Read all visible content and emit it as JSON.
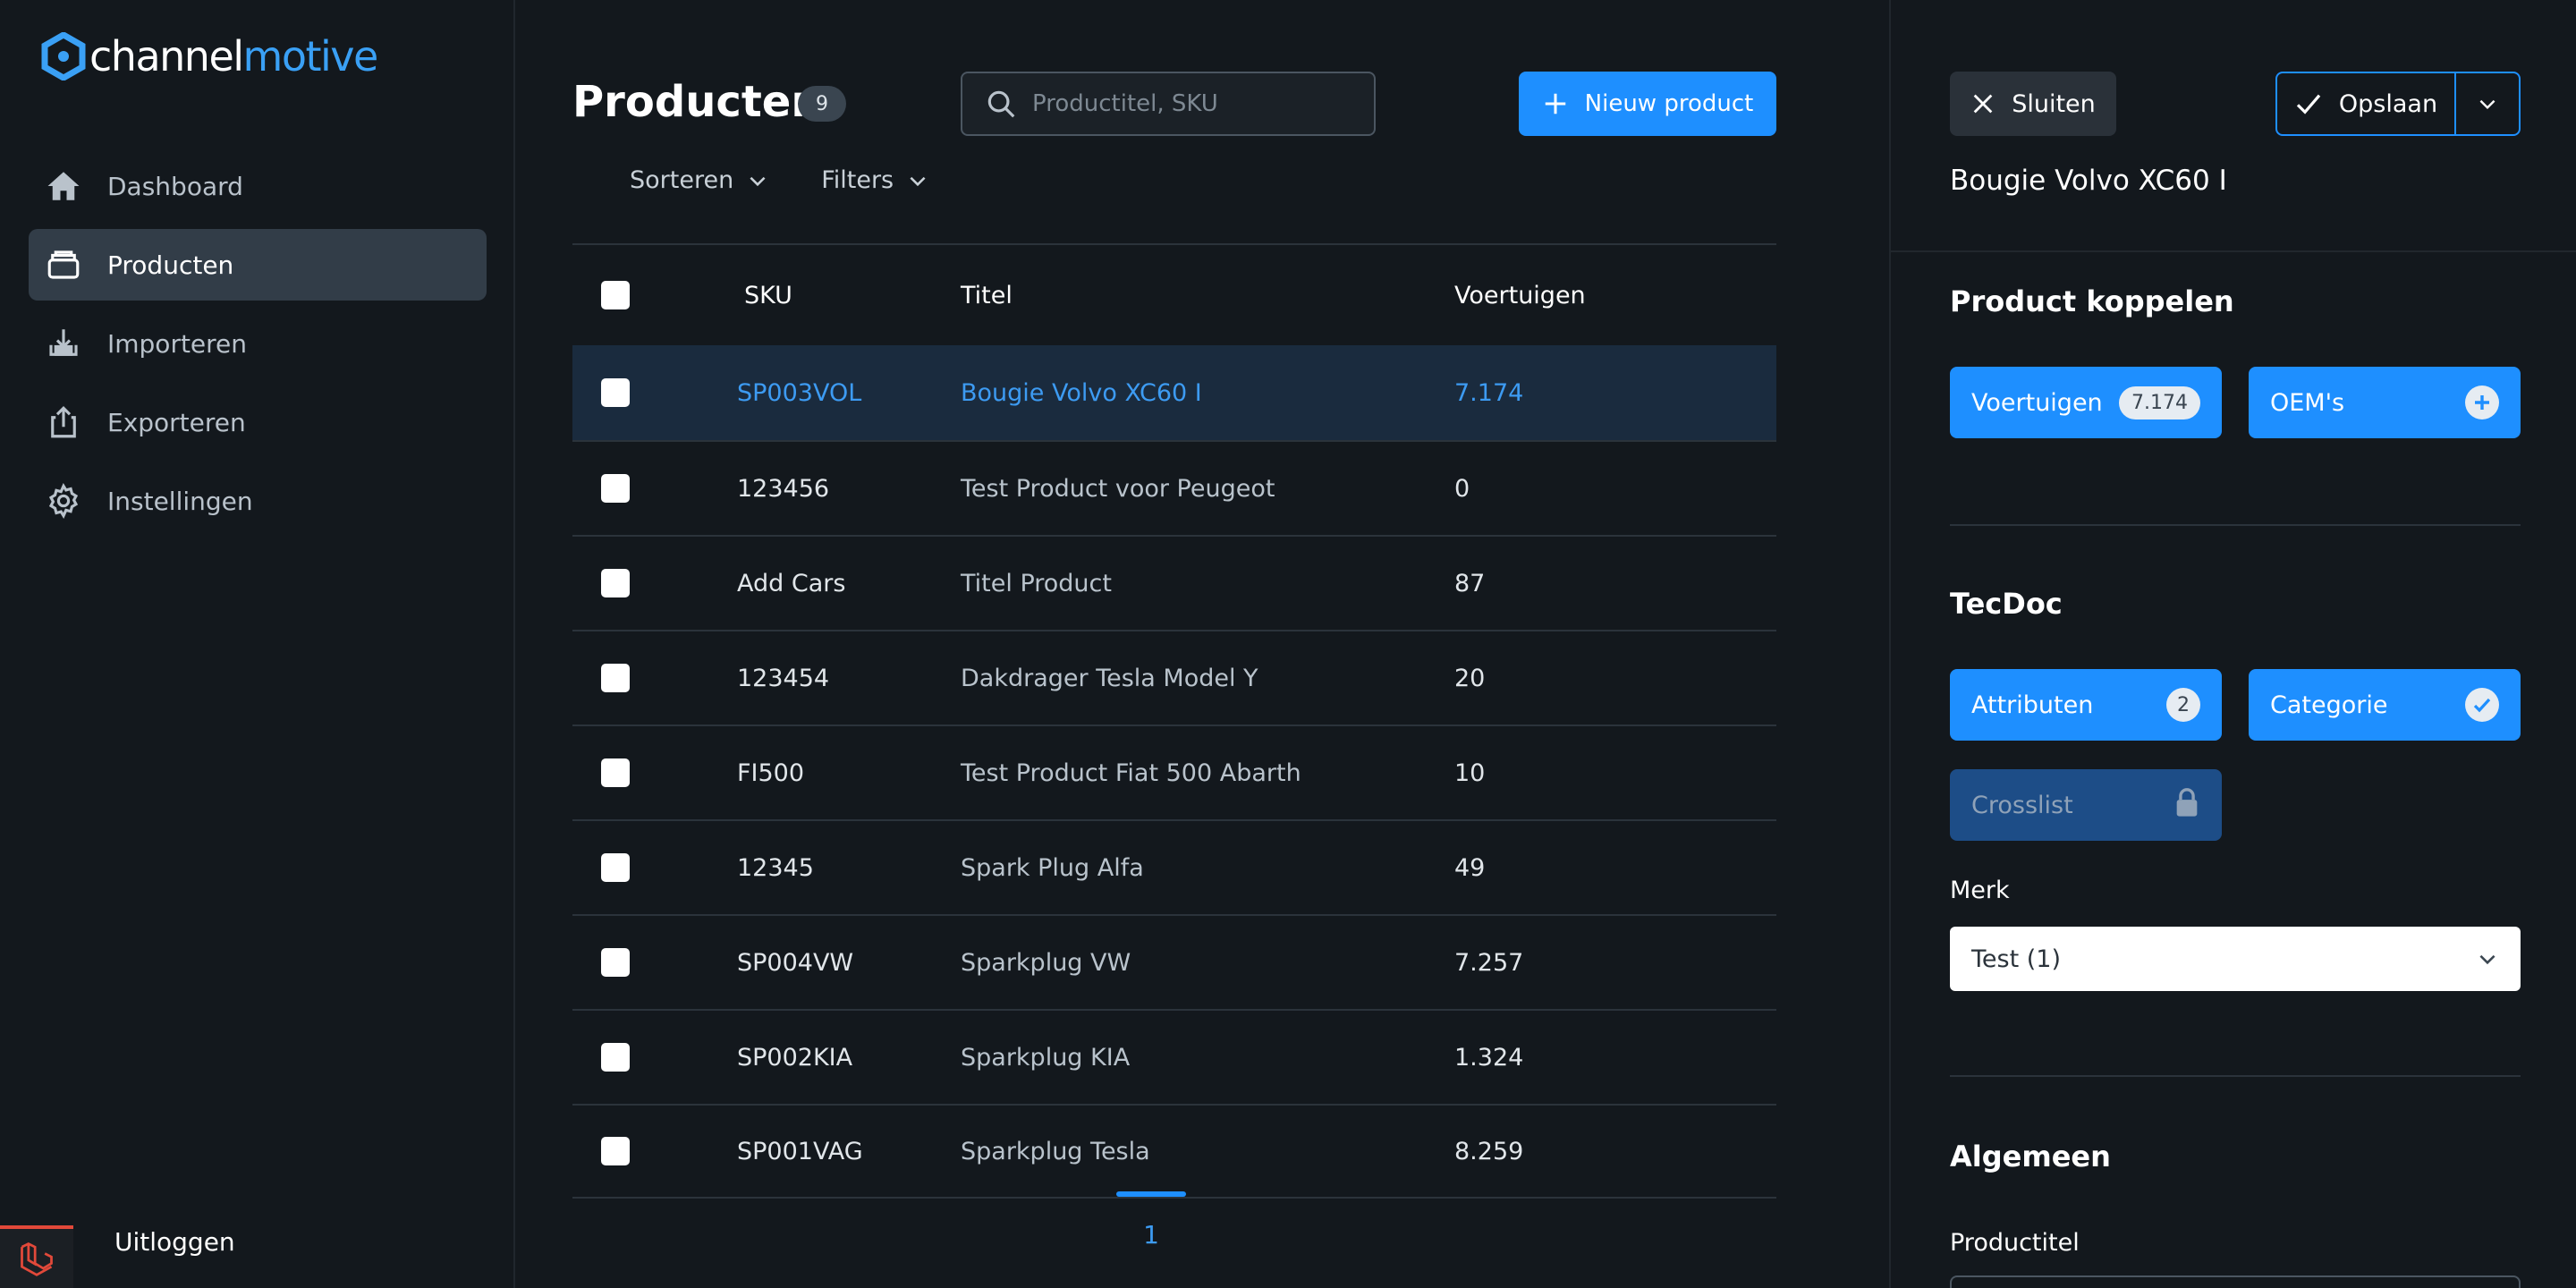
{
  "brand": {
    "part1": "channel",
    "part2": "motive"
  },
  "sidebar": {
    "items": [
      {
        "label": "Dashboard",
        "icon": "home-icon"
      },
      {
        "label": "Producten",
        "icon": "box-icon",
        "active": true
      },
      {
        "label": "Importeren",
        "icon": "import-icon"
      },
      {
        "label": "Exporteren",
        "icon": "export-icon"
      },
      {
        "label": "Instellingen",
        "icon": "gear-icon"
      }
    ],
    "logout": "Uitloggen"
  },
  "main": {
    "title": "Producten",
    "count": "9",
    "search_placeholder": "Productitel, SKU",
    "new_button": "Nieuw product",
    "sort_label": "Sorteren",
    "filters_label": "Filters",
    "columns": {
      "sku": "SKU",
      "title": "Titel",
      "vehicles": "Voertuigen"
    },
    "rows": [
      {
        "sku": "SP003VOL",
        "title": "Bougie Volvo XC60 I",
        "vehicles": "7.174",
        "selected": true
      },
      {
        "sku": "123456",
        "title": "Test Product voor Peugeot",
        "vehicles": "0"
      },
      {
        "sku": "Add Cars",
        "title": "Titel Product",
        "vehicles": "87"
      },
      {
        "sku": "123454",
        "title": "Dakdrager Tesla Model Y",
        "vehicles": "20"
      },
      {
        "sku": "FI500",
        "title": "Test Product Fiat 500 Abarth",
        "vehicles": "10"
      },
      {
        "sku": "12345",
        "title": "Spark Plug Alfa",
        "vehicles": "49"
      },
      {
        "sku": "SP004VW",
        "title": "Sparkplug VW",
        "vehicles": "7.257"
      },
      {
        "sku": "SP002KIA",
        "title": "Sparkplug KIA",
        "vehicles": "1.324"
      },
      {
        "sku": "SP001VAG",
        "title": "Sparkplug Tesla",
        "vehicles": "8.259"
      }
    ],
    "page": "1"
  },
  "panel": {
    "close_label": "Sluiten",
    "save_label": "Opslaan",
    "product_name": "Bougie Volvo XC60 I",
    "link_section": {
      "title": "Product koppelen",
      "vehicles_label": "Voertuigen",
      "vehicles_count": "7.174",
      "oem_label": "OEM's"
    },
    "tecdoc_section": {
      "title": "TecDoc",
      "attributes_label": "Attributen",
      "attributes_count": "2",
      "category_label": "Categorie",
      "crosslist_label": "Crosslist",
      "brand_label": "Merk",
      "brand_value": "Test (1)"
    },
    "general_section": {
      "title": "Algemeen",
      "product_title_label": "Productitel"
    }
  },
  "colors": {
    "accent": "#1e8fff",
    "background": "#13181d",
    "selected_row": "#1a2b3e"
  }
}
